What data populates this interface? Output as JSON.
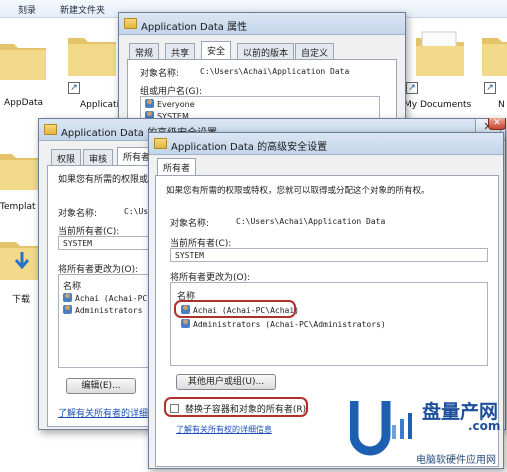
{
  "explorer": {
    "toolbar": [
      "刻录",
      "新建文件夹"
    ],
    "folders": [
      {
        "label": "AppData",
        "shortcut": false
      },
      {
        "label": "Applicati",
        "shortcut": true
      },
      {
        "label": "My Documents",
        "shortcut": true
      },
      {
        "label": "N",
        "shortcut": true
      },
      {
        "label": "Templat",
        "shortcut": false
      },
      {
        "label": "下载",
        "shortcut": false
      }
    ]
  },
  "props_dialog": {
    "title": "Application Data 属性",
    "tabs": [
      "常规",
      "共享",
      "安全",
      "以前的版本",
      "自定义"
    ],
    "active_tab": "安全",
    "object_name_label": "对象名称:",
    "object_name_value": "C:\\Users\\Achai\\Application Data",
    "group_label": "组或用户名(G):",
    "users": [
      "Everyone",
      "SYSTEM"
    ]
  },
  "adv1": {
    "title": "Application Data 的高级安全设置",
    "tabs": [
      "权限",
      "审核",
      "所有者"
    ],
    "active_tab": "所有者",
    "intro": "如果您有所需的权限或",
    "object_name_label": "对象名称:",
    "object_name_value": "C:\\Us",
    "current_owner_label": "当前所有者(C):",
    "current_owner_value": "SYSTEM",
    "change_owner_label": "将所有者更改为(O):",
    "list_header": "名称",
    "list_items": [
      "Achai (Achai-PC\\Ach",
      "Administrators (A"
    ],
    "edit_button": "编辑(E)...",
    "link": "了解有关所有者的详细"
  },
  "adv2": {
    "title": "Application Data 的高级安全设置",
    "tab": "所有者",
    "intro": "如果您有所需的权限或特权，您就可以取得或分配这个对象的所有权。",
    "object_name_label": "对象名称:",
    "object_name_value": "C:\\Users\\Achai\\Application Data",
    "current_owner_label": "当前所有者(C):",
    "current_owner_value": "SYSTEM",
    "change_owner_label": "将所有者更改为(O):",
    "list_header": "名称",
    "list_items": [
      "Achai (Achai-PC\\Achai)",
      "Administrators (Achai-PC\\Administrators)"
    ],
    "other_users_button": "其他用户或组(U)...",
    "replace_checkbox": "替换子容器和对象的所有者(R)",
    "replace_checked": false,
    "link": "了解有关所有权的详细信息"
  },
  "watermark": {
    "brand": "盘量产网",
    "domain": ".com",
    "tagline": "电脑软硬件应用网"
  },
  "colors": {
    "highlight": "#b0302a",
    "titlebar": "#c3d5ea",
    "link": "#1a4fb8"
  }
}
